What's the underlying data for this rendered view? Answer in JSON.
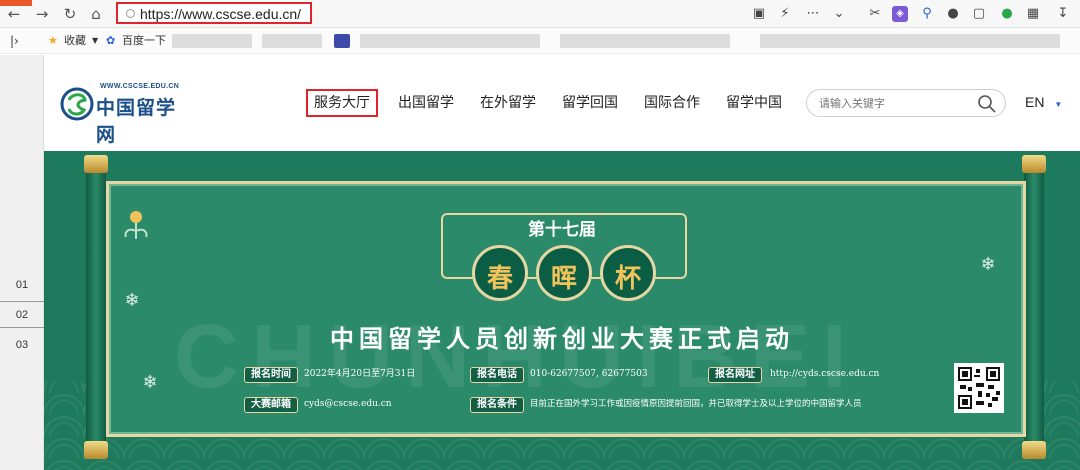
{
  "browser": {
    "url": "https://www.cscse.edu.cn/",
    "bookmarks": [
      {
        "label": "收藏"
      },
      {
        "label": "百度一下"
      }
    ],
    "lang_button": "EN"
  },
  "gutter": {
    "rows": [
      "01",
      "02",
      "03"
    ]
  },
  "site": {
    "logo_small": "WWW.CSCSE.EDU.CN",
    "logo_main": "中国留学网",
    "nav": [
      {
        "label": "服务大厅"
      },
      {
        "label": "出国留学"
      },
      {
        "label": "在外留学"
      },
      {
        "label": "留学回国"
      },
      {
        "label": "国际合作"
      },
      {
        "label": "留学中国"
      }
    ],
    "search_placeholder": "请输入关键字",
    "lang": "EN"
  },
  "banner": {
    "edition": "第十七届",
    "medals": [
      "春",
      "晖",
      "杯"
    ],
    "headline": "中国留学人员创新创业大赛正式启动",
    "info": [
      {
        "label": "报名时间",
        "value": "2022年4月20日至7月31日"
      },
      {
        "label": "报名电话",
        "value": "010-62677507, 62677503"
      },
      {
        "label": "报名网址",
        "value": "http://cyds.cscse.edu.cn"
      },
      {
        "label": "大赛邮箱",
        "value": "cyds@cscse.edu.cn"
      },
      {
        "label": "报名条件",
        "value": "目前正在国外学习工作或因疫情原因提前回国，并已取得学士及以上学位的中国留学人员"
      }
    ]
  },
  "colors": {
    "highlight": "#e0242b",
    "banner_green": "#1e7a5c",
    "gold": "#e6d7a4",
    "brand_blue": "#1b4f8a"
  }
}
